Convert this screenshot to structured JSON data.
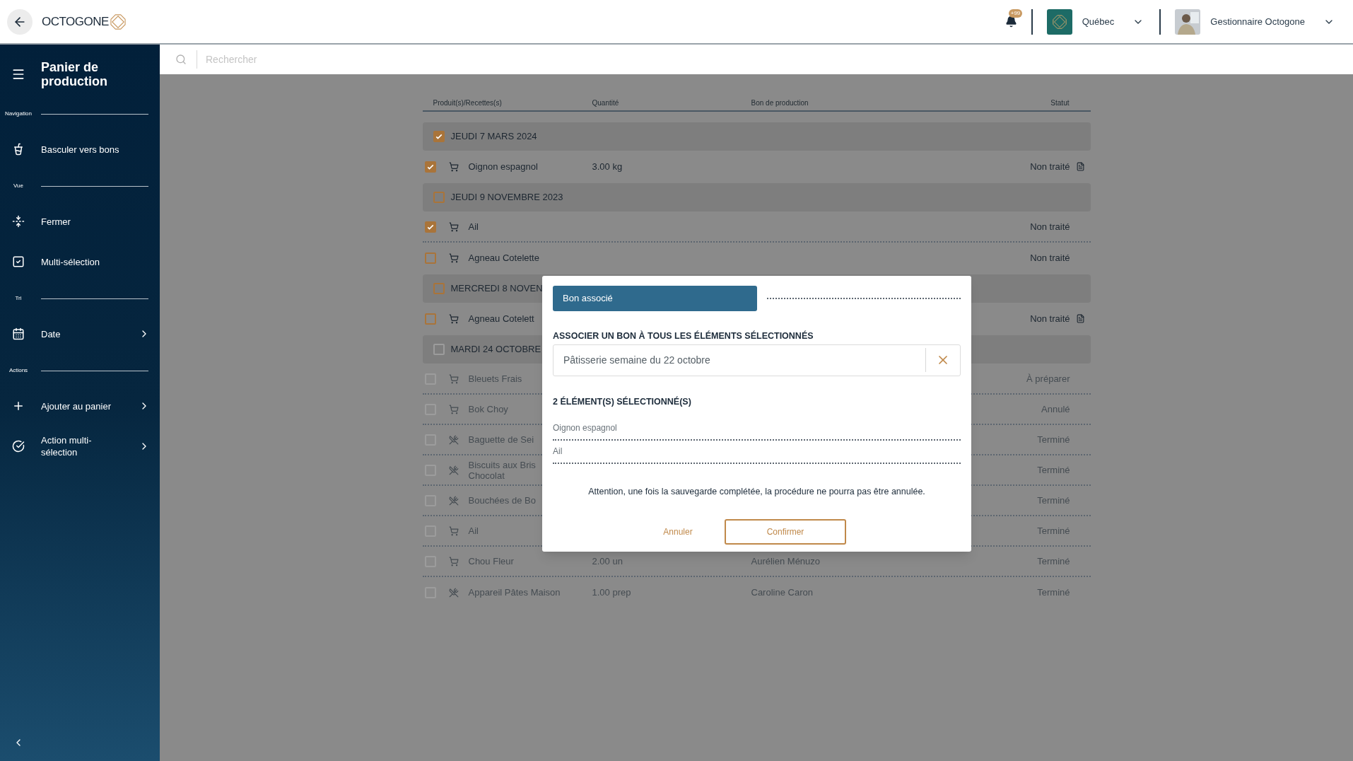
{
  "header": {
    "logo": "OCTOGONE",
    "notifications_badge": "+99",
    "location": "Québec",
    "user": "Gestionnaire Octogone"
  },
  "sidebar": {
    "title": "Panier de production",
    "sections": [
      {
        "label": "Navigation",
        "items": [
          {
            "label": "Basculer vers bons",
            "submenu": false
          }
        ]
      },
      {
        "label": "Vue",
        "items": [
          {
            "label": "Fermer",
            "submenu": false
          },
          {
            "label": "Multi-sélection",
            "submenu": false
          }
        ]
      },
      {
        "label": "Tri",
        "items": [
          {
            "label": "Date",
            "submenu": true
          }
        ]
      },
      {
        "label": "Actions",
        "items": [
          {
            "label": "Ajouter au panier",
            "submenu": true
          },
          {
            "label": "Action multi-sélection",
            "submenu": true
          }
        ]
      }
    ]
  },
  "search": {
    "placeholder": "Rechercher"
  },
  "table": {
    "columns": [
      "Produit(s)/Recettes(s)",
      "Quantité",
      "Bon de production",
      "Statut"
    ],
    "groups": [
      {
        "label": "JEUDI 7 MARS 2024",
        "checked": true,
        "disabled": false,
        "rows": [
          {
            "kind": "product",
            "name": "Oignon espagnol",
            "quantity": "3.00 kg",
            "status": "Non traité",
            "checked": true,
            "disabled": false,
            "document": true
          }
        ]
      },
      {
        "label": "JEUDI 9 NOVEMBRE 2023",
        "checked": false,
        "disabled": false,
        "rows": [
          {
            "kind": "product",
            "name": "Ail",
            "status": "Non traité",
            "checked": true,
            "disabled": false,
            "document": false
          },
          {
            "kind": "product",
            "name": "Agneau Cotelette",
            "status": "Non traité",
            "checked": false,
            "disabled": false,
            "document": false
          }
        ]
      },
      {
        "label": "MERCREDI 8 NOVEN",
        "checked": false,
        "disabled": false,
        "rows": [
          {
            "kind": "product",
            "name": "Agneau Cotelett",
            "status": "Non traité",
            "checked": false,
            "disabled": false,
            "document": true
          }
        ]
      },
      {
        "label": "MARDI 24 OCTOBRE",
        "checked": false,
        "disabled": true,
        "rows": [
          {
            "kind": "product",
            "name": "Bleuets Frais",
            "status": "À préparer",
            "checked": false,
            "disabled": true,
            "document": false
          },
          {
            "kind": "product",
            "name": "Bok Choy",
            "status": "Annulé",
            "checked": false,
            "disabled": true,
            "document": false
          },
          {
            "kind": "recipe",
            "name": "Baguette de Sei",
            "status": "Terminé",
            "checked": false,
            "disabled": true,
            "document": false
          },
          {
            "kind": "recipe",
            "name": "Biscuits aux Bris Chocolat",
            "status": "Terminé",
            "checked": false,
            "disabled": true,
            "document": false
          },
          {
            "kind": "recipe",
            "name": "Bouchées de Bo",
            "status": "Terminé",
            "checked": false,
            "disabled": true,
            "document": false
          },
          {
            "kind": "product",
            "name": "Ail",
            "status": "Terminé",
            "checked": false,
            "disabled": true,
            "document": false
          },
          {
            "kind": "product",
            "name": "Chou Fleur",
            "quantity": "2.00 un",
            "bon": "Aurélien Ménuzo",
            "status": "Terminé",
            "checked": false,
            "disabled": true,
            "document": false
          },
          {
            "kind": "recipe",
            "name": "Appareil Pâtes Maison",
            "quantity": "1.00 prep",
            "bon": "Caroline Caron",
            "status": "Terminé",
            "checked": false,
            "disabled": true,
            "document": false
          }
        ]
      }
    ]
  },
  "dialog": {
    "tab": "Bon associé",
    "field_label": "ASSOCIER UN BON À TOUS LES ÉLÉMENTS SÉLECTIONNÉS",
    "field_value": "Pâtisserie semaine du 22 octobre",
    "selection_title": "2 ÉLÉMENT(S) SÉLECTIONNÉ(S)",
    "selected_items": [
      "Oignon espagnol",
      "Ail"
    ],
    "warning": "Attention, une fois la sauvegarde complétée, la procédure ne pourra pas être annulée.",
    "buttons": [
      {
        "label": "Annuler",
        "kind": "text"
      },
      {
        "label": "Confirmer",
        "kind": "outlined"
      }
    ]
  }
}
